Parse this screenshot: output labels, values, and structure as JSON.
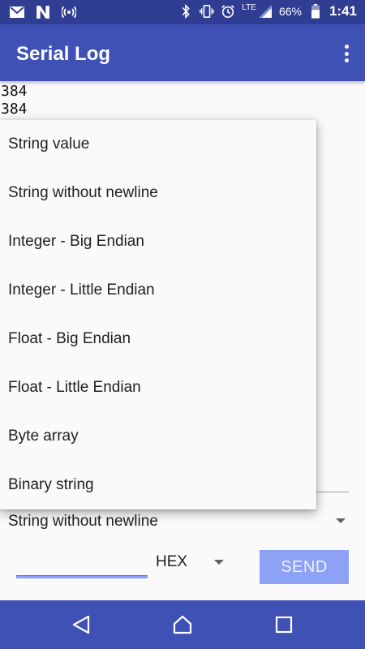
{
  "status_bar": {
    "battery": "66%",
    "time": "1:41",
    "network": "LTE",
    "left_icons": [
      "gmail-icon",
      "n-app-icon",
      "hotspot-icon"
    ],
    "right_icons": [
      "bluetooth-icon",
      "vibrate-icon",
      "alarm-icon",
      "signal-icon",
      "battery-icon"
    ]
  },
  "app_bar": {
    "title": "Serial Log",
    "overflow_icon": "more-vert-icon"
  },
  "log": {
    "lines": [
      "384",
      "384"
    ]
  },
  "spinner": {
    "selected": "String without newline"
  },
  "input": {
    "value": "",
    "format": "HEX",
    "send_label": "SEND"
  },
  "popup": {
    "items": [
      "String value",
      "String without newline",
      "Integer - Big Endian",
      "Integer - Little Endian",
      "Float - Big Endian",
      "Float - Little Endian",
      "Byte array",
      "Binary string"
    ]
  },
  "nav": {
    "icons": [
      "back-icon",
      "home-icon",
      "recents-icon"
    ]
  },
  "colors": {
    "primary": "#3f51b5",
    "primary_dark": "#2f3e93",
    "accent": "#536dfe",
    "send_disabled": "#8ea2f5"
  }
}
